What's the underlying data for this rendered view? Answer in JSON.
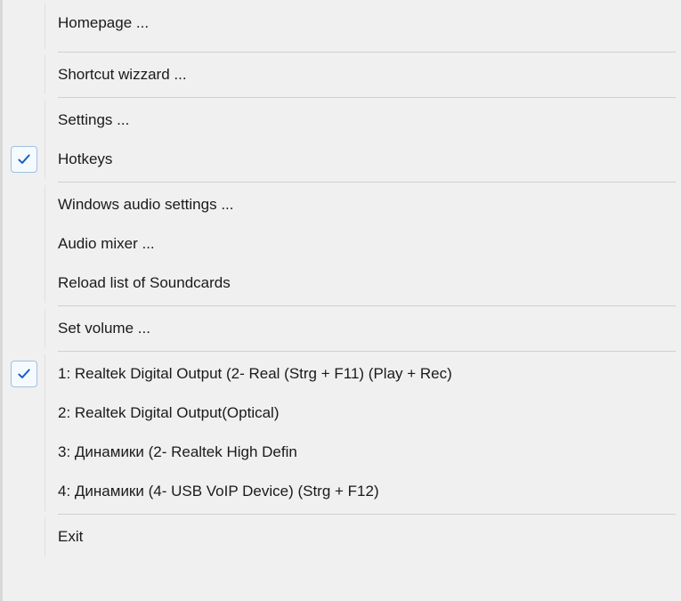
{
  "menu": {
    "groups": [
      [
        {
          "label": "Homepage ...",
          "checked": false
        }
      ],
      [
        {
          "label": "Shortcut wizzard ...",
          "checked": false
        }
      ],
      [
        {
          "label": "Settings ...",
          "checked": false
        },
        {
          "label": "Hotkeys",
          "checked": true
        }
      ],
      [
        {
          "label": "Windows audio settings ...",
          "checked": false
        },
        {
          "label": "Audio mixer ...",
          "checked": false
        },
        {
          "label": "Reload list of Soundcards",
          "checked": false
        }
      ],
      [
        {
          "label": "Set volume ...",
          "checked": false
        }
      ],
      [
        {
          "label": "1: Realtek Digital Output (2- Real   (Strg + F11)     (Play + Rec)",
          "checked": true
        },
        {
          "label": "2: Realtek Digital Output(Optical)",
          "checked": false
        },
        {
          "label": "3: Динамики (2- Realtek High Defin",
          "checked": false
        },
        {
          "label": "4: Динамики (4- USB VoIP Device)   (Strg + F12)",
          "checked": false
        }
      ],
      [
        {
          "label": "Exit",
          "checked": false
        }
      ]
    ]
  }
}
